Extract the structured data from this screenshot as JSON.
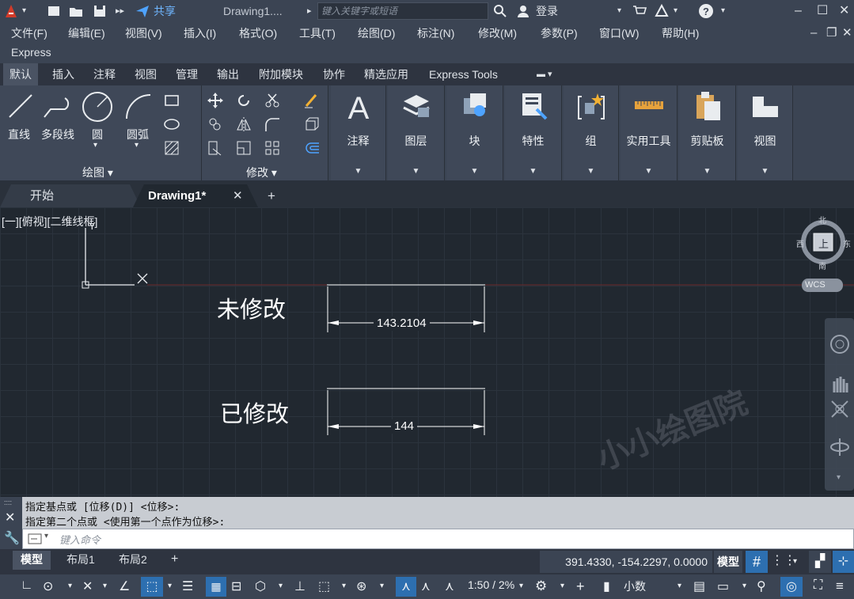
{
  "titlebar": {
    "share": "共享",
    "doc_title": "Drawing1....",
    "search_placeholder": "键入关键字或短语",
    "login": "登录"
  },
  "menubar": {
    "items": [
      "文件(F)",
      "编辑(E)",
      "视图(V)",
      "插入(I)",
      "格式(O)",
      "工具(T)",
      "绘图(D)",
      "标注(N)",
      "修改(M)",
      "参数(P)",
      "窗口(W)",
      "帮助(H)"
    ],
    "extra": "Express"
  },
  "ribbon_tabs": [
    "默认",
    "插入",
    "注释",
    "视图",
    "管理",
    "输出",
    "附加模块",
    "协作",
    "精选应用",
    "Express Tools"
  ],
  "ribbon": {
    "draw": {
      "line": "直线",
      "polyline": "多段线",
      "circle": "圆",
      "arc": "圆弧",
      "title": "绘图 ▾"
    },
    "modify": {
      "title": "修改 ▾"
    },
    "panels": [
      "注释",
      "图层",
      "块",
      "特性",
      "组",
      "实用工具",
      "剪贴板",
      "视图"
    ]
  },
  "doc_tabs": {
    "start": "开始",
    "drawing": "Drawing1*"
  },
  "canvas": {
    "view_label": "[一][俯视][二维线框]",
    "label_unmodified": "未修改",
    "label_modified": "已修改",
    "dim_unmodified": "143.2104",
    "dim_modified": "144",
    "ucs_y": "Y",
    "watermark": "小小绘图院",
    "viewcube": {
      "north": "北",
      "south": "南",
      "east": "东",
      "west": "西",
      "top": "上",
      "wcs": "WCS"
    }
  },
  "command": {
    "history": [
      "指定基点或 [位移(D)] <位移>:",
      "指定第二个点或 <使用第一个点作为位移>:"
    ],
    "input_placeholder": "键入命令"
  },
  "layout_tabs": [
    "模型",
    "布局1",
    "布局2"
  ],
  "status": {
    "coords": "391.4330, -154.2297, 0.0000",
    "model": "模型",
    "scale": "1:50 / 2%",
    "units": "小数"
  },
  "colors": {
    "accent": "#2d6fb0",
    "canvas": "#212830",
    "panel": "#3b4453"
  }
}
